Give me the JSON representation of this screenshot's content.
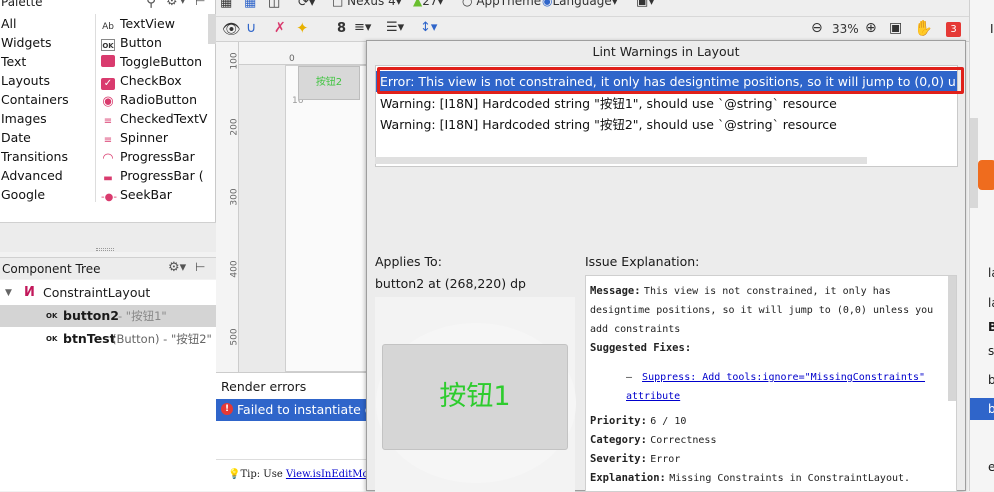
{
  "palette": {
    "header": "Palette",
    "categories": [
      "All",
      "Widgets",
      "Text",
      "Layouts",
      "Containers",
      "Images",
      "Date",
      "Transitions",
      "Advanced",
      "Google"
    ],
    "widgets": [
      {
        "label": "TextView",
        "icon": "Ab"
      },
      {
        "label": "Button",
        "icon": "OK"
      },
      {
        "label": "ToggleButton",
        "icon": "toggle"
      },
      {
        "label": "CheckBox",
        "icon": "check"
      },
      {
        "label": "RadioButton",
        "icon": "radio"
      },
      {
        "label": "CheckedTextV",
        "icon": "checked"
      },
      {
        "label": "Spinner",
        "icon": "spinner"
      },
      {
        "label": "ProgressBar",
        "icon": "progress"
      },
      {
        "label": "ProgressBar (",
        "icon": "progress-h"
      },
      {
        "label": "SeekBar",
        "icon": "seek"
      }
    ]
  },
  "component_tree": {
    "title": "Component Tree",
    "root": "ConstraintLayout",
    "items": [
      {
        "name": "button2",
        "detail": "- \"按钮1\""
      },
      {
        "name": "btnTest",
        "detail": "(Button) - \"按钮2\""
      }
    ]
  },
  "toolbar": {
    "device": "Nexus 4",
    "api": "27",
    "theme": "AppTheme",
    "language": "Language",
    "zoom": "33%",
    "margin": "8",
    "error_count": "3"
  },
  "rulers": {
    "v": [
      "100",
      "200",
      "300",
      "400",
      "500"
    ],
    "h": [
      "0"
    ],
    "h2": "16"
  },
  "canvas": {
    "button_text": "按钮2"
  },
  "render_errors": {
    "title": "Render errors",
    "error": "Failed to instantiate one",
    "tip_prefix": "Tip: Use ",
    "tip_link": "View.isInEditMode()"
  },
  "lint": {
    "title": "Lint Warnings in Layout",
    "rows": [
      "Error: This view is not constrained, it only has designtime positions, so it will jump to (0,0) unless you add constraints",
      "Warning: [I18N] Hardcoded string \"按钮1\", should use `@string` resource",
      "Warning: [I18N] Hardcoded string \"按钮2\", should use `@string` resource"
    ],
    "applies_to_label": "Applies To:",
    "applies_to_value": "button2 at (268,220) dp",
    "preview_text": "按钮1",
    "explanation_label": "Issue Explanation:",
    "explanation": {
      "message_label": "Message:",
      "message": "This view is not constrained, it only has designtime positions, so it will jump to (0,0) unless you add constraints",
      "fixes_label": "Suggested Fixes:",
      "fix_bullet": "–",
      "fix_link": "Suppress: Add tools:ignore=\"MissingConstraints\" attribute",
      "priority_label": "Priority:",
      "priority": "6 / 10",
      "category_label": "Category:",
      "category": "Correctness",
      "severity_label": "Severity:",
      "severity": "Error",
      "explanation_label2": "Explanation:",
      "explanation_text": "Missing Constraints in ConstraintLayout."
    }
  },
  "right_strip": {
    "items": [
      "la",
      "la",
      "B",
      "s",
      "b",
      "b",
      "e"
    ],
    "top": "I"
  },
  "colors": {
    "selection": "#2f65ca",
    "error_red": "#e53935",
    "green_text": "#2ecc2e",
    "error_box_border": "#e0201a"
  }
}
